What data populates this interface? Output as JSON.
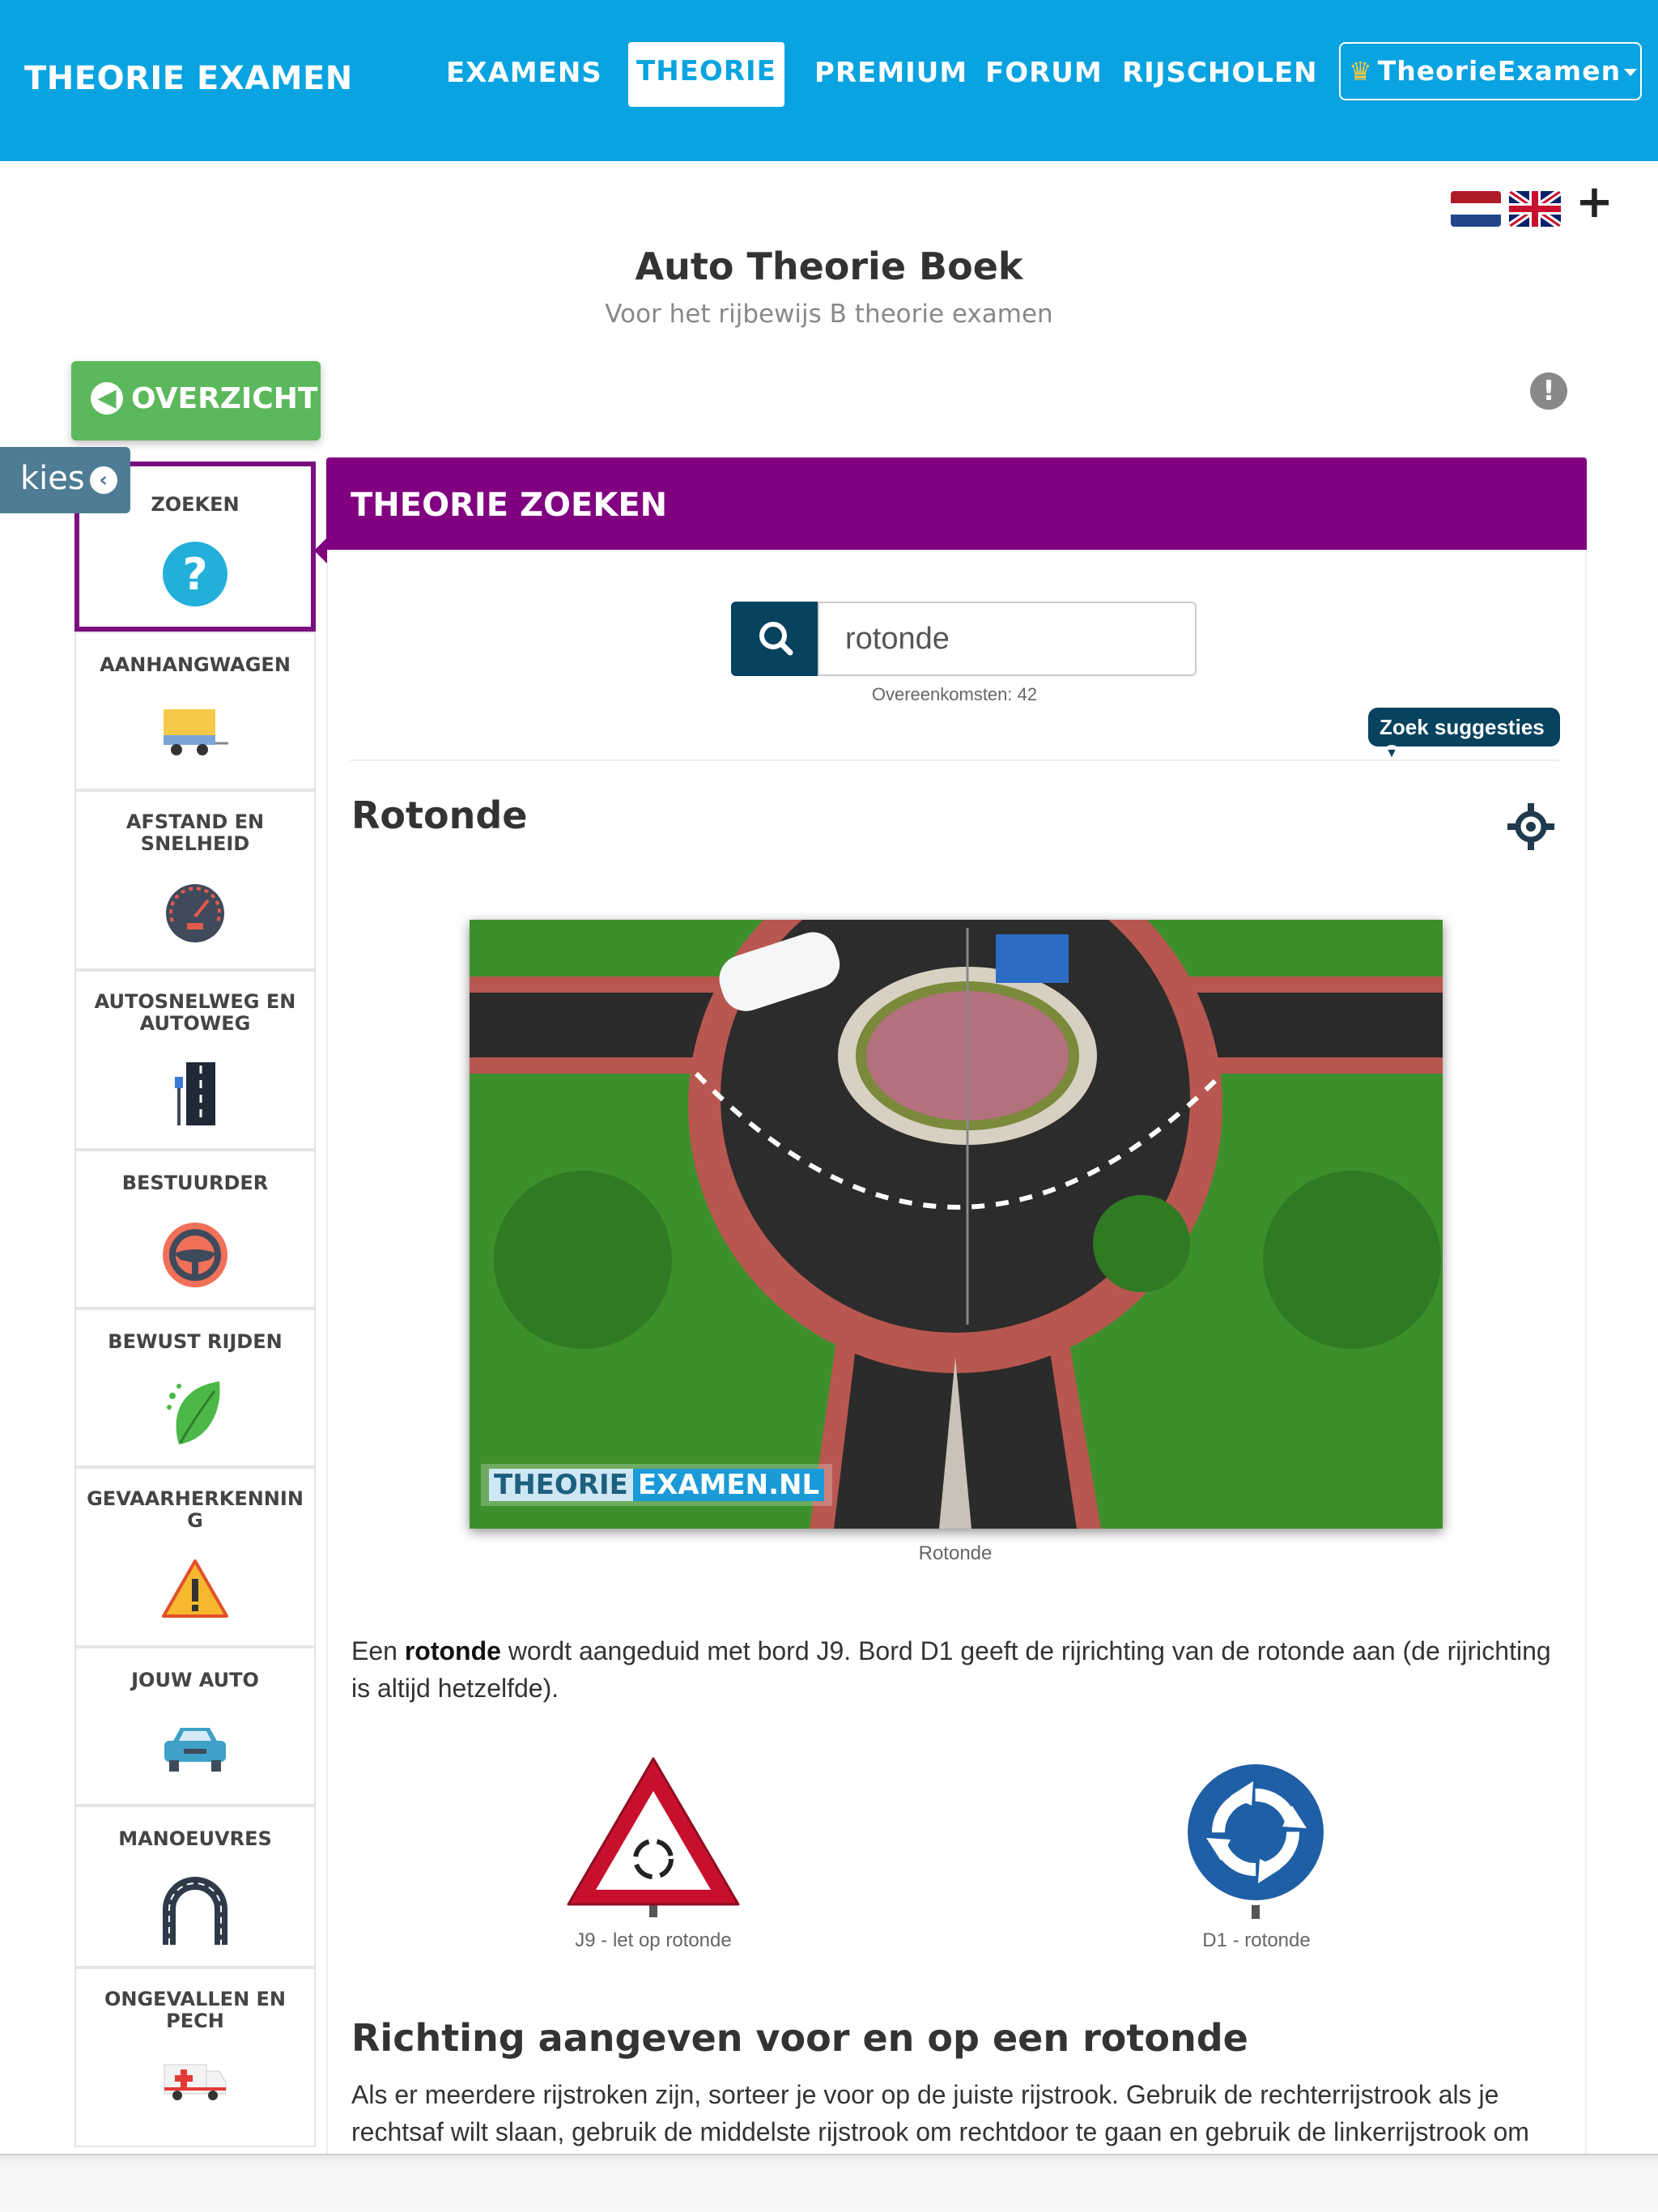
{
  "navbar": {
    "brand": "THEORIE EXAMEN",
    "items": [
      {
        "label": "EXAMENS"
      },
      {
        "label": "THEORIE"
      },
      {
        "label": "PREMIUM"
      },
      {
        "label": "FORUM"
      },
      {
        "label": "RIJSCHOLEN"
      }
    ],
    "active_item": "THEORIE",
    "account_label": "TheorieExamen",
    "colors": {
      "bar": "#08a3e0",
      "active_text": "#08a3e0",
      "crown": "#f6c945"
    }
  },
  "languages": {
    "flags": [
      "nl-flag",
      "gb-flag"
    ],
    "add_icon": "plus-icon"
  },
  "header": {
    "title": "Auto Theorie Boek",
    "subtitle": "Voor het rijbewijs B theorie examen"
  },
  "overview_button": {
    "label": "OVERZICHT",
    "color": "#5cb85c"
  },
  "kies_tab": {
    "label": "kies"
  },
  "sidebar": {
    "items": [
      {
        "label": "ZOEKEN",
        "icon": "question-icon",
        "active": true
      },
      {
        "label": "AANHANGWAGEN",
        "icon": "trailer-icon"
      },
      {
        "label": "AFSTAND EN SNELHEID",
        "icon": "speedometer-icon"
      },
      {
        "label": "AUTOSNELWEG EN AUTOWEG",
        "icon": "highway-icon"
      },
      {
        "label": "BESTUURDER",
        "icon": "steering-wheel-icon"
      },
      {
        "label": "BEWUST RIJDEN",
        "icon": "leaf-icon"
      },
      {
        "label": "GEVAARHERKENNING",
        "icon": "warning-icon"
      },
      {
        "label": "JOUW AUTO",
        "icon": "car-icon"
      },
      {
        "label": "MANOEUVRES",
        "icon": "u-turn-icon"
      },
      {
        "label": "ONGEVALLEN EN PECH",
        "icon": "ambulance-icon"
      }
    ],
    "active_color": "#7a0f80"
  },
  "panel": {
    "header": "THEORIE ZOEKEN",
    "header_color": "#800080",
    "search": {
      "value": "rotonde",
      "button_icon": "search-icon"
    },
    "matches": "Overeenkomsten: 42",
    "suggestions_label": "Zoek suggesties"
  },
  "article": {
    "title": "Rotonde",
    "title_icon": "roundabout-icon",
    "image": {
      "watermark_a": "THEORIE",
      "watermark_b": "EXAMEN.NL",
      "caption": "Rotonde"
    },
    "paragraph": {
      "before": "Een ",
      "bold": "rotonde",
      "after": " wordt aangeduid met bord J9. Bord D1 geeft de rijrichting van de rotonde aan (de rijrichting is altijd hetzelfde)."
    },
    "signs": [
      {
        "code": "J9",
        "caption": "J9 - let op rotonde"
      },
      {
        "code": "D1",
        "caption": "D1 - rotonde"
      }
    ],
    "section2": {
      "title": "Richting aangeven voor en op een rotonde",
      "text": "Als er meerdere rijstroken zijn, sorteer je voor op de juiste rijstrook. Gebruik de rechterrijstrook als je rechtsaf wilt slaan, gebruik de middelste rijstrook om rechtdoor te gaan en gebruik de linkerrijstrook om naar links te gaan, tenzij borden en markeringen anders aangeven."
    }
  }
}
